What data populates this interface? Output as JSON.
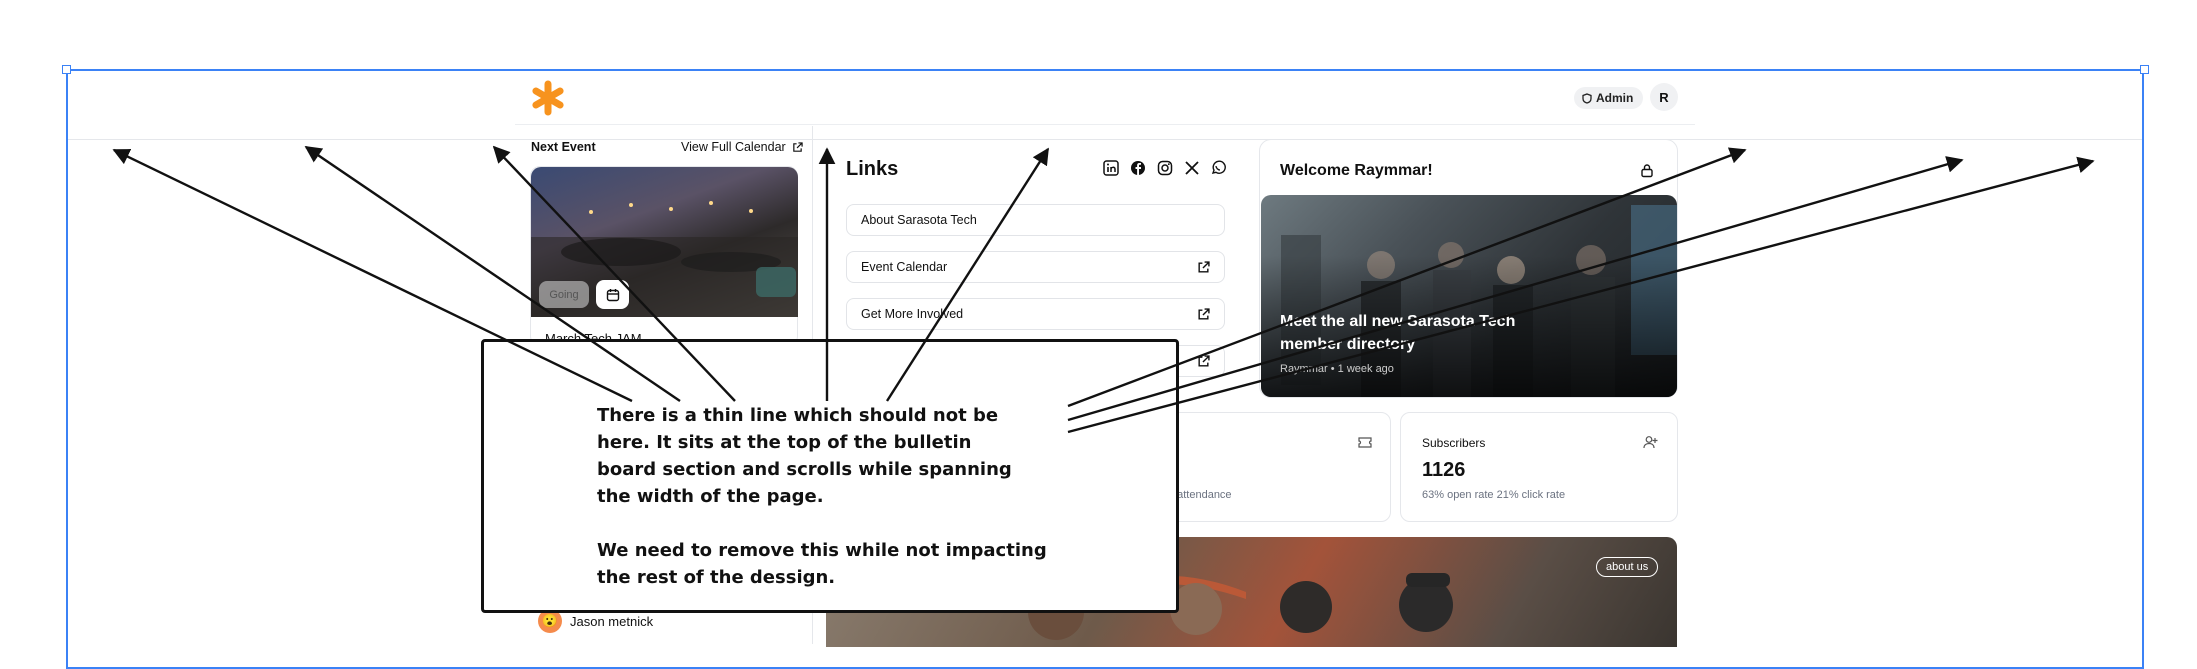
{
  "header": {
    "admin_label": "Admin",
    "avatar_initial": "R"
  },
  "next_event": {
    "label": "Next Event",
    "calendar_link": "View Full Calendar",
    "event_title": "March Tech JAM",
    "going_label": "Going"
  },
  "links": {
    "title": "Links",
    "social_icons": [
      "linkedin-icon",
      "facebook-icon",
      "instagram-icon",
      "x-icon",
      "whatsapp-icon"
    ],
    "items": [
      {
        "label": "About Sarasota Tech",
        "external": false
      },
      {
        "label": "Event Calendar",
        "external": true
      },
      {
        "label": "Get More Involved",
        "external": true
      },
      {
        "label": "",
        "external": true
      }
    ]
  },
  "welcome": {
    "title": "Welcome Raymmar!",
    "feature_headline": "Meet the all new Sarasota Tech member directory",
    "feature_author": "Raymmar",
    "feature_time": "1 week ago"
  },
  "stats": {
    "attendance_sub": "t attendance",
    "subscribers_label": "Subscribers",
    "subscribers_value": "1126",
    "subscribers_sub": "63% open rate 21% click rate"
  },
  "about": {
    "badge": "about us"
  },
  "members": {
    "first_name": "Jason metnick"
  },
  "annotation": {
    "text": "There is a thin line which should not be\nhere. It sits at the top of the bulletin\nboard section and scrolls while spanning\nthe width of the page.\n\nWe need to remove this while not impacting\nthe rest of the dessign."
  },
  "colors": {
    "selection": "#3b82f6",
    "logo": "#f7931e",
    "border": "#e5e7eb"
  }
}
